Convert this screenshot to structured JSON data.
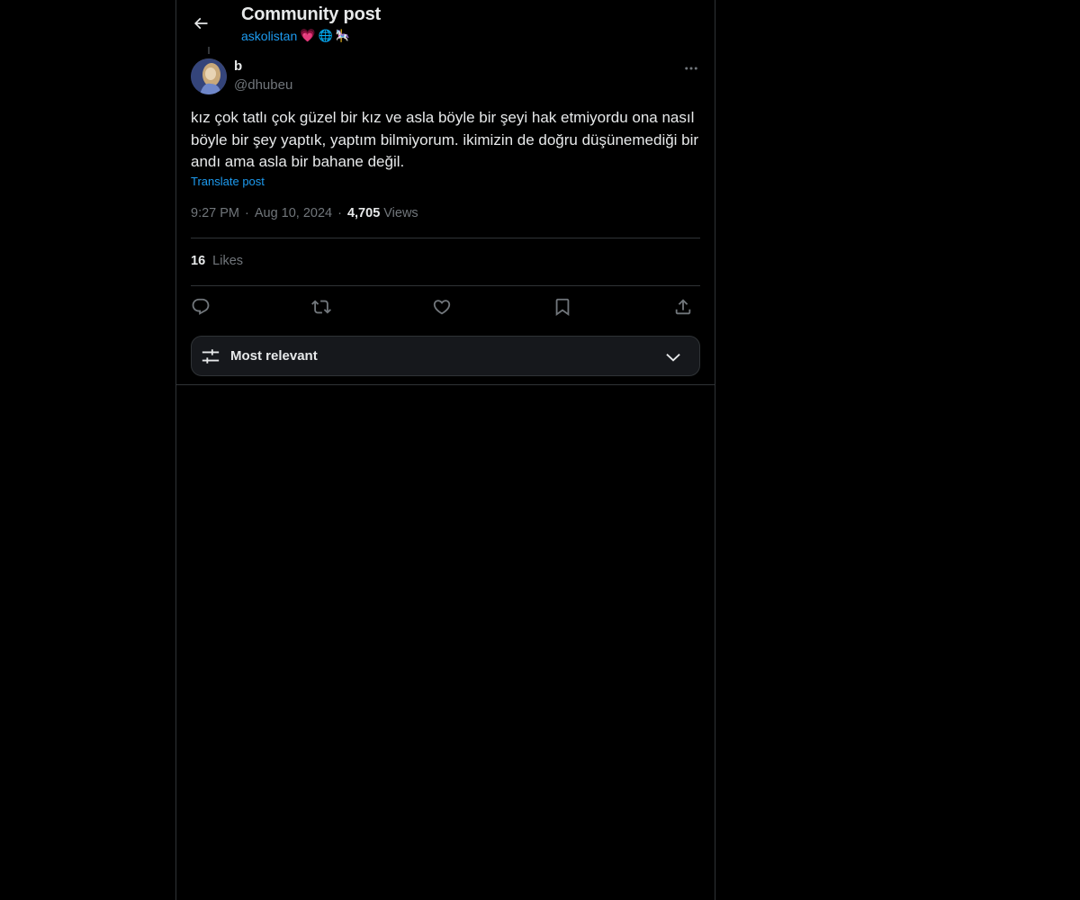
{
  "header": {
    "title": "Community post",
    "community_name": "askolistan",
    "community_emojis": [
      "💗",
      "🌐",
      "🎠"
    ],
    "back_icon": "arrow-left-icon"
  },
  "post": {
    "author_name": "b",
    "author_handle": "@dhubeu",
    "text": "kız çok tatlı çok güzel bir kız ve asla böyle bir şeyi hak etmiyordu ona nasıl böyle bir şey yaptık, yaptım bilmiyorum. ikimizin de doğru düşünemediği bir andı ama asla bir bahane değil.",
    "translate_label": "Translate post",
    "time": "9:27 PM",
    "date": "Aug 10, 2024",
    "meta_separator": "·",
    "views_count": "4,705",
    "views_label": "Views",
    "likes_count": "16",
    "likes_label": "Likes"
  },
  "actions": {
    "reply_icon": "reply-icon",
    "repost_icon": "repost-icon",
    "like_icon": "heart-icon",
    "bookmark_icon": "bookmark-icon",
    "share_icon": "share-icon"
  },
  "sort": {
    "label": "Most relevant",
    "icon": "sliders-icon",
    "chevron": "chevron-down-icon"
  },
  "colors": {
    "background": "#000000",
    "text_primary": "#e7e9ea",
    "text_secondary": "#71767b",
    "accent": "#1d9bf0",
    "border": "#2f3336"
  }
}
